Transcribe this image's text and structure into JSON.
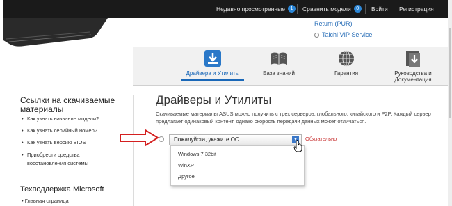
{
  "topbar": {
    "recent_label": "Недавно просмотренные",
    "recent_count": "1",
    "compare_label": "Сравнить модели",
    "compare_count": "0",
    "login_label": "Войти",
    "register_label": "Регистрация"
  },
  "product_links": {
    "return": "Return (PUR)",
    "vip": "Taichi VIP Service"
  },
  "tabs": [
    {
      "label": "Драйвера и Утилиты",
      "icon": "download-box-icon"
    },
    {
      "label": "База знаний",
      "icon": "book-icon"
    },
    {
      "label": "Гарантия",
      "icon": "globe-icon"
    },
    {
      "label": "Руководства и Документация",
      "icon": "documents-icon"
    }
  ],
  "sidebar": {
    "title": "Ссылки на скачиваемые материалы",
    "links": [
      "Как узнать название модели?",
      "Как узнать серийный номер?",
      "Как узнать версию BIOS",
      "Приобрести средства восстановления системы"
    ],
    "title2": "Техподдержка Microsoft",
    "links2": [
      "Главная страница"
    ]
  },
  "main": {
    "title": "Драйверы и Утилиты",
    "description": "Скачиваемые материалы ASUS можно получить с трех серверов: глобального, китайского и P2P. Каждый сервер предлагает одинаковый контент, однако скорость передачи данных может отличаться.",
    "os_select_value": "Пожалуйста, укажите ОС",
    "required_label": "Обязательно",
    "os_options": [
      "Windows 7 32bit",
      "WinXP",
      "Другое"
    ]
  },
  "colors": {
    "accent": "#1a68b8",
    "required": "#c83232",
    "topbar": "#1a1a1a"
  }
}
